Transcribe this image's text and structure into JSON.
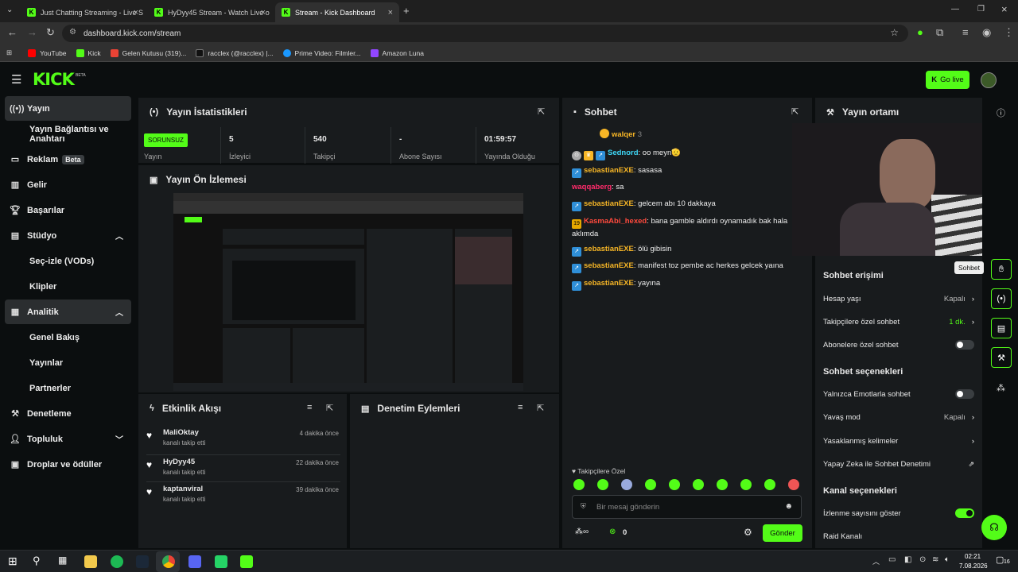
{
  "browser": {
    "tabs": [
      {
        "title": "Just Chatting Streaming - Live S",
        "active": false
      },
      {
        "title": "HyDyy45 Stream - Watch Live o",
        "active": false
      },
      {
        "title": "Stream - Kick Dashboard",
        "active": true
      }
    ],
    "url": "dashboard.kick.com/stream",
    "bookmarks": [
      "YouTube",
      "Kick",
      "Gelen Kutusu (319)...",
      "racclex (@racclex) |...",
      "Prime Video: Filmler...",
      "Amazon Luna"
    ]
  },
  "header": {
    "logo": "KICK",
    "logo_badge": "BETA",
    "go_live": "Go live"
  },
  "sidebar": {
    "items": [
      {
        "label": "Yayın",
        "icon": "broadcast-icon"
      },
      {
        "label": "Yayın Bağlantısı ve Anahtarı"
      },
      {
        "label": "Reklam",
        "badge": "Beta",
        "icon": "ad-icon"
      },
      {
        "label": "Gelir",
        "icon": "revenue-icon"
      },
      {
        "label": "Başarılar",
        "icon": "trophy-icon"
      },
      {
        "label": "Stüdyo",
        "icon": "studio-icon"
      },
      {
        "label": "Seç-izle (VODs)"
      },
      {
        "label": "Klipler"
      },
      {
        "label": "Analitik",
        "icon": "analytics-icon"
      },
      {
        "label": "Genel Bakış"
      },
      {
        "label": "Yayınlar"
      },
      {
        "label": "Partnerler"
      },
      {
        "label": "Denetleme",
        "icon": "moderation-icon"
      },
      {
        "label": "Topluluk",
        "icon": "community-icon"
      },
      {
        "label": "Droplar ve ödüller",
        "icon": "drops-icon"
      }
    ]
  },
  "stats": {
    "title": "Yayın İstatistikleri",
    "status_badge": "SORUNSUZ",
    "status_label": "Yayın",
    "items": [
      {
        "value": "5",
        "label": "İzleyici"
      },
      {
        "value": "540",
        "label": "Takipçi"
      },
      {
        "value": "-",
        "label": "Abone Sayısı"
      },
      {
        "value": "01:59:57",
        "label": "Yayında Olduğu"
      }
    ]
  },
  "preview": {
    "title": "Yayın Ön İzlemesi"
  },
  "activity": {
    "title": "Etkinlik Akışı",
    "items": [
      {
        "name": "MaliOktay",
        "sub": "kanalı takip etti",
        "time": "4 dakika önce"
      },
      {
        "name": "HyDyy45",
        "sub": "kanalı takip etti",
        "time": "22 dakika önce"
      },
      {
        "name": "kaptanviral",
        "sub": "kanalı takip etti",
        "time": "39 dakika önce"
      }
    ]
  },
  "moderation": {
    "title": "Denetim Eylemleri"
  },
  "chat": {
    "title": "Sohbet",
    "pinned_user": "walqer",
    "pinned_count": "3",
    "messages": [
      {
        "user": "Sednord",
        "text": ": oo meyn🫡",
        "color": "#3ed6f5"
      },
      {
        "user": "sebastianEXE",
        "text": ": sasasa",
        "color": "#f7b626"
      },
      {
        "user": "waqqaberg",
        "text": ": sa",
        "color": "#ff2b6b"
      },
      {
        "user": "sebastianEXE",
        "text": ": gelcem abı 10 dakkaya",
        "color": "#f7b626"
      },
      {
        "user": "KasmaAbi_hexed",
        "text": ": bana gamble aldırdı oynamadık bak hala aklımda",
        "color": "#ff4a3d"
      },
      {
        "user": "sebastianEXE",
        "text": ": ölü gibisin",
        "color": "#f7b626"
      },
      {
        "user": "sebastianEXE",
        "text": ": manifest toz pembe ac herkes gelcek yaına",
        "color": "#f7b626"
      },
      {
        "user": "sebastianEXE",
        "text": ": yayına",
        "color": "#f7b626"
      }
    ],
    "emote_label": "Takipçilere Özel",
    "placeholder": "Bir mesaj gönderin",
    "count": "0",
    "send": "Gönder"
  },
  "settings": {
    "title": "Yayın ortamı",
    "tooltip": "Sohbet",
    "access_heading": "Sohbet erişimi",
    "account_age": {
      "label": "Hesap yaşı",
      "value": "Kapalı"
    },
    "followers_only": {
      "label": "Takipçilere özel sohbet",
      "value": "1 dk."
    },
    "subs_only": {
      "label": "Abonelere özel sohbet",
      "on": false
    },
    "options_heading": "Sohbet seçenekleri",
    "emotes_only": {
      "label": "Yalnızca Emotlarla sohbet",
      "on": false
    },
    "slow_mode": {
      "label": "Yavaş mod",
      "value": "Kapalı"
    },
    "banned_words": {
      "label": "Yasaklanmış kelimeler"
    },
    "ai_mod": {
      "label": "Yapay Zeka ile Sohbet Denetimi"
    },
    "channel_heading": "Kanal seçenekleri",
    "show_viewers": {
      "label": "İzlenme sayısını göster",
      "on": true
    },
    "raid": {
      "label": "Raid Kanalı"
    }
  },
  "taskbar": {
    "time": "02:21",
    "date": "7.08.2026",
    "notif": "16"
  },
  "colors": {
    "accent": "#53fc18",
    "panel": "#181b1d",
    "bg": "#0b0e0f"
  }
}
